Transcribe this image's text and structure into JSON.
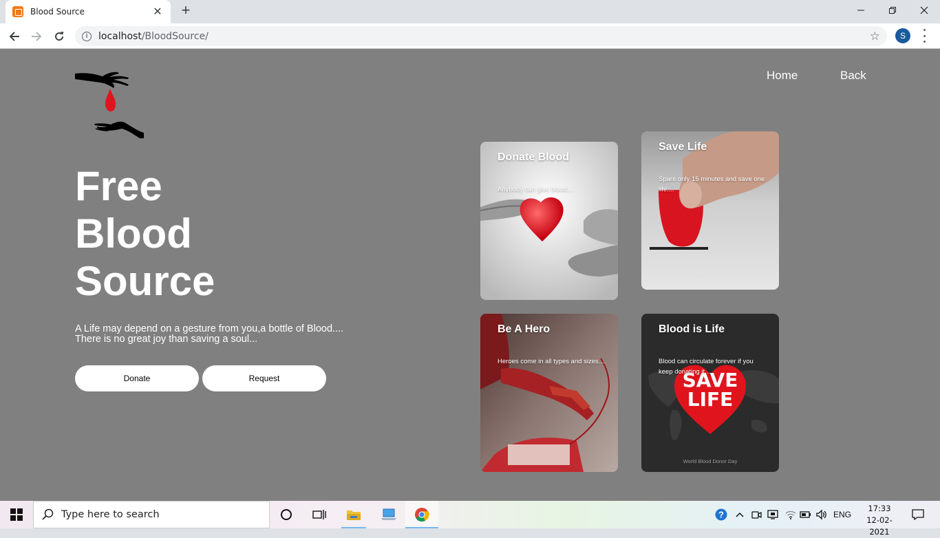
{
  "browser": {
    "tab_title": "Blood Source",
    "url_host": "localhost",
    "url_path": "/BloodSource/",
    "profile_initial": "S"
  },
  "nav": {
    "home": "Home",
    "back": "Back"
  },
  "hero": {
    "title_line1": "Free",
    "title_line2": "Blood",
    "title_line3": "Source",
    "text_line1": "A Life may depend on a gesture from you,a bottle of Blood....",
    "text_line2": "There is no great joy than saving a soul...",
    "donate_label": "Donate",
    "request_label": "Request"
  },
  "cards": [
    {
      "title": "Donate Blood",
      "text": "Anybody can give blood...."
    },
    {
      "title": "Save Life",
      "text": "Spare only 15 minutes and save one life...."
    },
    {
      "title": "Be A Hero",
      "text": "Heroes come in all types and sizes...."
    },
    {
      "title": "Blood is Life",
      "text": "Blood can circulate forever if you keep donating it....",
      "art_text_line1": "SAVE",
      "art_text_line2": "LIFE",
      "art_caption": "World Blood Donor Day"
    }
  ],
  "taskbar": {
    "search_placeholder": "Type here to search",
    "language": "ENG",
    "time": "17:33",
    "date": "12-02-2021"
  },
  "colors": {
    "page_bg": "#808080",
    "blood_red": "#e0141c",
    "button_bg": "#ffffff"
  }
}
